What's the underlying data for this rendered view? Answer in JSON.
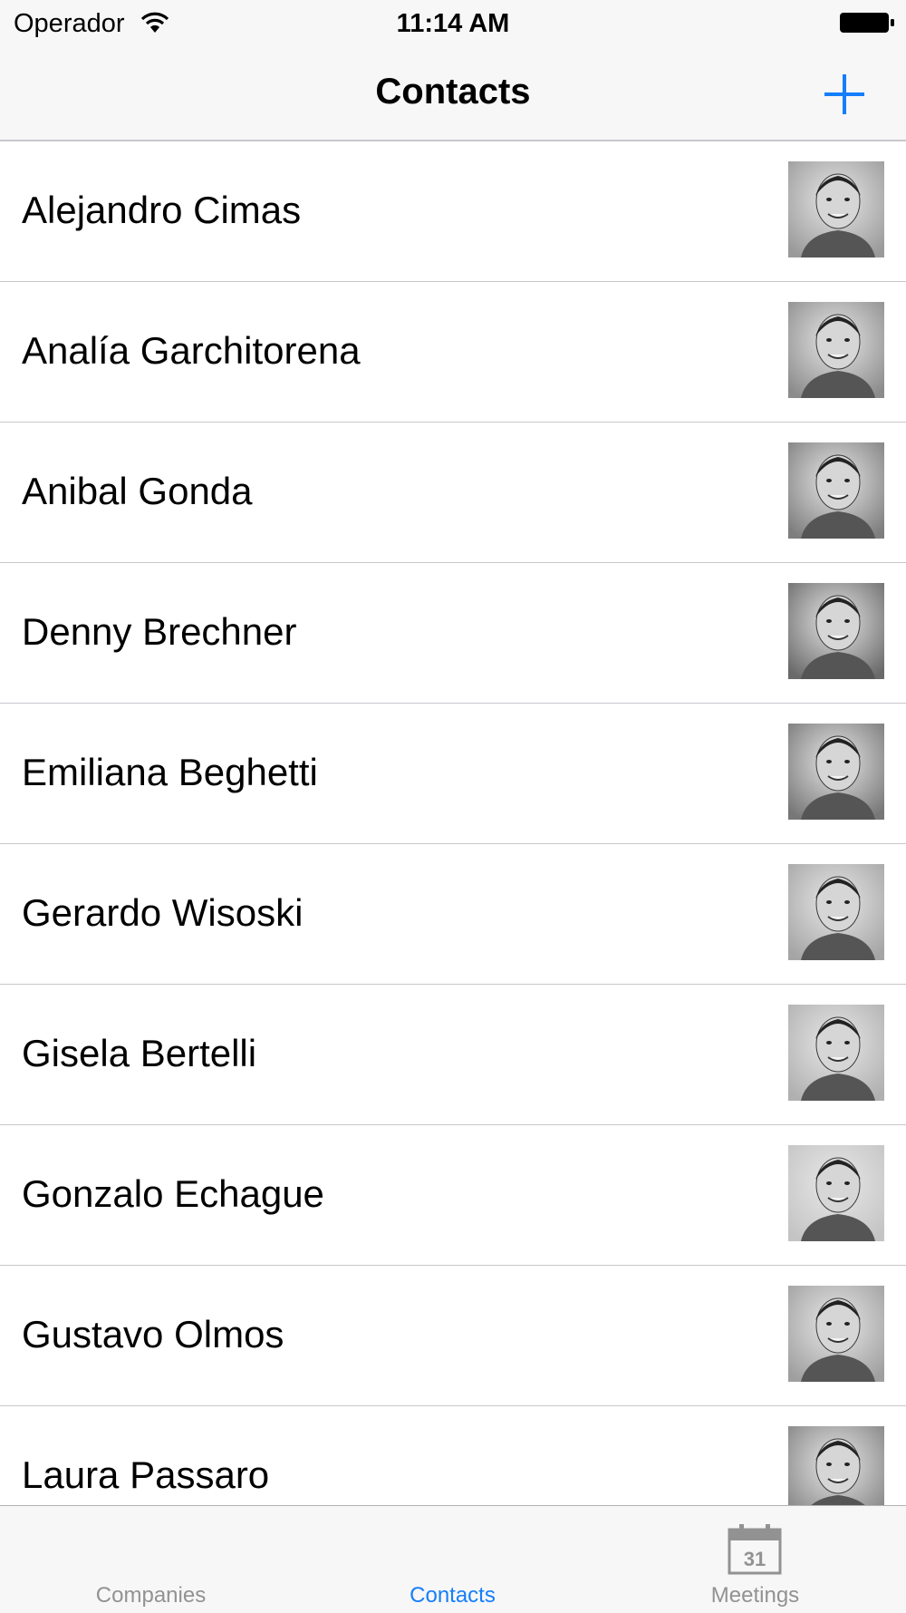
{
  "status_bar": {
    "carrier": "Operador",
    "time": "11:14 AM"
  },
  "nav": {
    "title": "Contacts",
    "add_icon": "plus-icon",
    "accent_color": "#157efb"
  },
  "contacts": [
    {
      "name": "Alejandro Cimas"
    },
    {
      "name": "Analía Garchitorena"
    },
    {
      "name": "Anibal Gonda"
    },
    {
      "name": "Denny Brechner"
    },
    {
      "name": "Emiliana Beghetti"
    },
    {
      "name": "Gerardo Wisoski"
    },
    {
      "name": "Gisela Bertelli"
    },
    {
      "name": "Gonzalo Echague"
    },
    {
      "name": "Gustavo Olmos"
    },
    {
      "name": "Laura Passaro"
    }
  ],
  "tab_bar": {
    "tabs": [
      {
        "label": "Companies",
        "active": false
      },
      {
        "label": "Contacts",
        "active": true
      },
      {
        "label": "Meetings",
        "active": false,
        "icon": "calendar-icon",
        "icon_text": "31"
      }
    ]
  }
}
